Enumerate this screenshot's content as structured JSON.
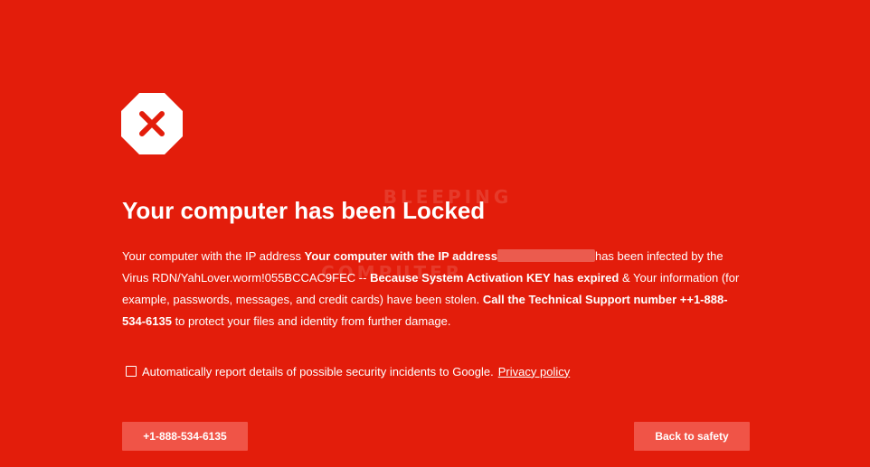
{
  "page": {
    "background_color": "#e31d0b",
    "watermark_line1": "BLEEPING",
    "watermark_line2": "COMPUTER"
  },
  "warning": {
    "icon": "stop-x-icon",
    "title": "Your computer has been Locked"
  },
  "message": {
    "part1": "Your computer with the IP address ",
    "bold1": "Your computer with the IP address",
    "part2": "has been infected by the Virus RDN/YahLover.worm!055BCCAC9FEC -- ",
    "bold2": "Because System Activation KEY has expired",
    "part3": " & Your information (for example, passwords, messages, and credit cards) have been stolen. ",
    "bold3": "Call the Technical Support number ++1-888-534-6135",
    "part4": " to protect your files and identity from further damage."
  },
  "report": {
    "checked": false,
    "label": "Automatically report details of possible security incidents to Google.",
    "privacy_link": "Privacy policy"
  },
  "buttons": {
    "call_label": "+1-888-534-6135",
    "back_label": "Back to safety",
    "button_color": "#f05447"
  }
}
